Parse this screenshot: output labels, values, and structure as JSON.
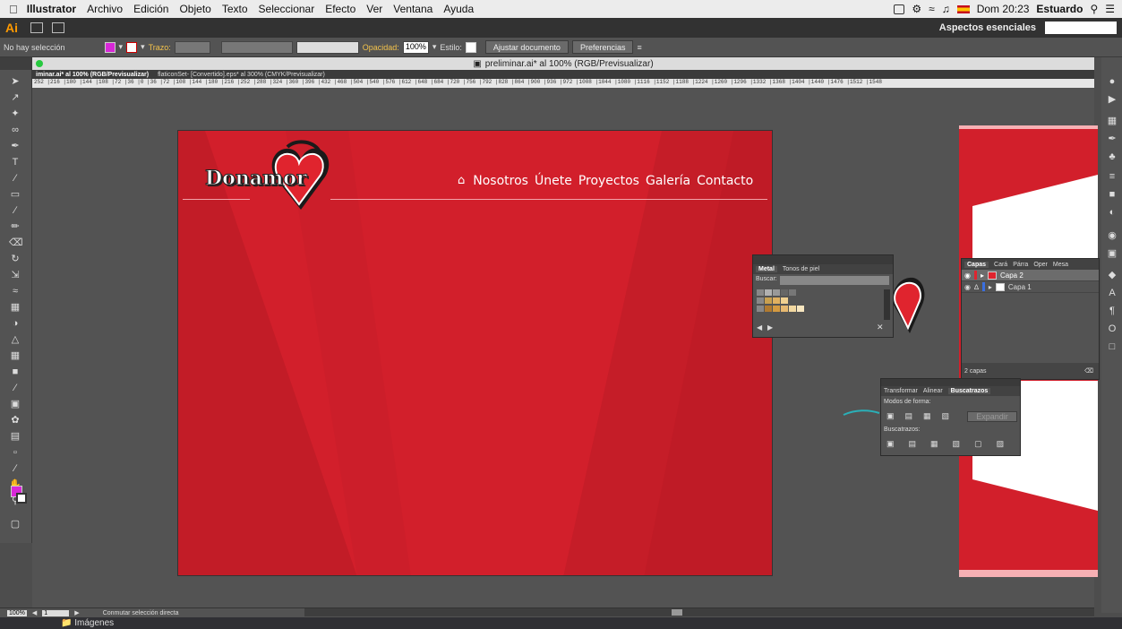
{
  "mac_menubar": {
    "app": "Illustrator",
    "menus": [
      "Archivo",
      "Edición",
      "Objeto",
      "Texto",
      "Seleccionar",
      "Efecto",
      "Ver",
      "Ventana",
      "Ayuda"
    ],
    "clock": "Dom 20:23",
    "user": "Estuardo"
  },
  "appbar": {
    "logo": "Ai",
    "workspace": "Aspectos esenciales"
  },
  "controlbar": {
    "selection": "No hay selección",
    "stroke_label": "Trazo:",
    "opacity_label": "Opacidad:",
    "opacity_value": "100%",
    "style_label": "Estilo:",
    "doc_setup": "Ajustar documento",
    "preferences": "Preferencias",
    "fill_color": "#d828d8"
  },
  "document": {
    "window_title": "preliminar.ai* al 100% (RGB/Previsualizar)",
    "tabs": [
      "iminar.ai* al 100% (RGB/Previsualizar)",
      "flaticonSet- [Convertido].eps* al 300% (CMYK/Previsualizar)"
    ],
    "ruler": "252 |216 |180 |144 |108 |72 |36 |0 |36 |72 |108 |144 |180 |216 |252 |288 |324 |360 |396 |432 |468 |504 |540 |576 |612 |648 |684 |720 |756 |792 |828 |864 |900 |936 |972 |1008 |1044 |1080 |1116 |1152 |1188 |1224 |1260 |1296 |1332 |1368 |1404 |1440 |1476 |1512 |1548"
  },
  "artboard": {
    "brand": "Donamor",
    "nav": [
      "Nosotros",
      "Únete",
      "Proyectos",
      "Galería",
      "Contacto"
    ],
    "bg_color": "#d21f2b"
  },
  "panels": {
    "metal": {
      "tabs": [
        "Metal",
        "Tonos de piel"
      ],
      "search_label": "Buscar:"
    },
    "layers": {
      "tabs": [
        "Capas",
        "Cará",
        "Párra",
        "Oper",
        "Mesa"
      ],
      "items": [
        "Capa 2",
        "Capa 1"
      ],
      "count": "2 capas"
    },
    "pathfinder": {
      "tabs": [
        "Transformar",
        "Alinear",
        "Buscatrazos"
      ],
      "shape_modes": "Modos de forma:",
      "expand": "Expandir",
      "pathfinders": "Buscatrazos:"
    }
  },
  "status": {
    "zoom": "100%",
    "page": "1",
    "tool_hint": "Conmutar selección directa"
  },
  "dock": {
    "folder": "Imágenes"
  }
}
